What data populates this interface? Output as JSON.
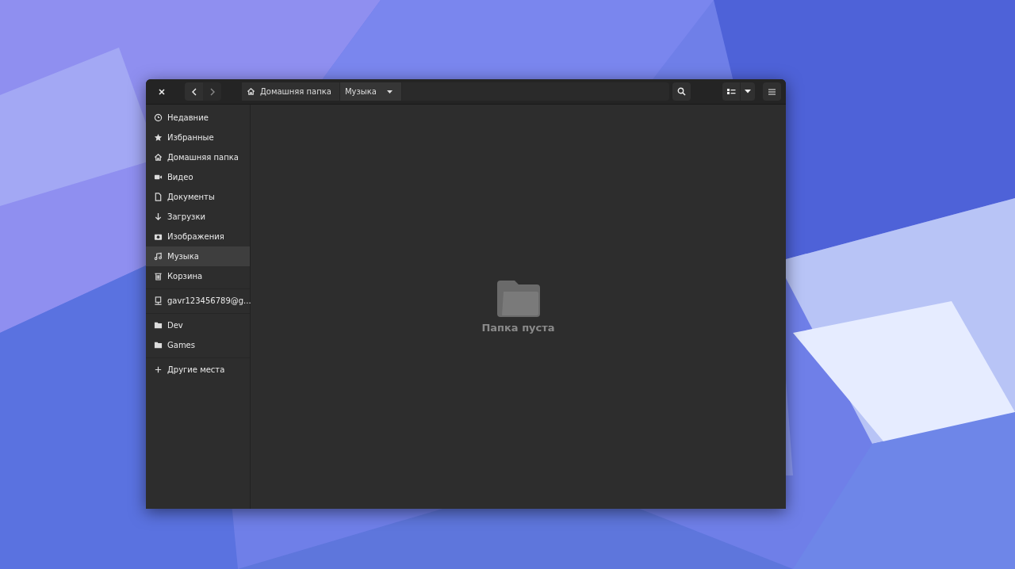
{
  "window": {
    "breadcrumb": [
      {
        "label": "Домашняя папка",
        "selected": false
      },
      {
        "label": "Музыка",
        "selected": true
      }
    ]
  },
  "sidebar": {
    "sections": [
      {
        "items": [
          {
            "label": "Недавние",
            "selected": false
          },
          {
            "label": "Избранные",
            "selected": false
          },
          {
            "label": "Домашняя папка",
            "selected": false
          },
          {
            "label": "Видео",
            "selected": false
          },
          {
            "label": "Документы",
            "selected": false
          },
          {
            "label": "Загрузки",
            "selected": false
          },
          {
            "label": "Изображения",
            "selected": false
          },
          {
            "label": "Музыка",
            "selected": true
          },
          {
            "label": "Корзина",
            "selected": false
          }
        ]
      },
      {
        "items": [
          {
            "label": "gavr123456789@g...",
            "selected": false
          }
        ]
      },
      {
        "items": [
          {
            "label": "Dev",
            "selected": false
          },
          {
            "label": "Games",
            "selected": false
          }
        ]
      },
      {
        "items": [
          {
            "label": "Другие места",
            "selected": false
          }
        ]
      }
    ]
  },
  "content": {
    "empty_message": "Папка пуста"
  }
}
